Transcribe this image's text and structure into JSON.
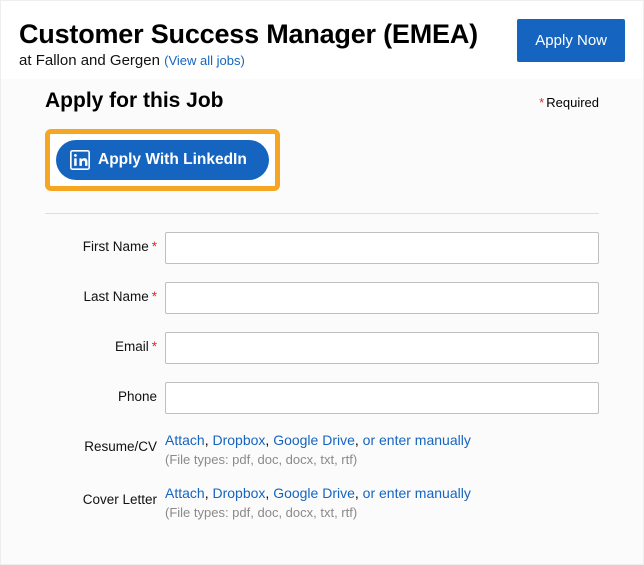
{
  "header": {
    "job_title": "Customer Success Manager (EMEA)",
    "at_prefix": "at ",
    "company": "Fallon and Gergen",
    "view_all": "(View all jobs)",
    "apply_now": "Apply Now"
  },
  "form": {
    "title": "Apply for this Job",
    "required_label": "Required",
    "linkedin_button": "Apply With LinkedIn",
    "fields": {
      "first_name": {
        "label": "First Name",
        "required": true
      },
      "last_name": {
        "label": "Last Name",
        "required": true
      },
      "email": {
        "label": "Email",
        "required": true
      },
      "phone": {
        "label": "Phone",
        "required": false
      },
      "resume": {
        "label": "Resume/CV"
      },
      "cover": {
        "label": "Cover Letter"
      }
    },
    "attach": {
      "links": {
        "attach": "Attach",
        "dropbox": "Dropbox",
        "gdrive": "Google Drive",
        "manual": "or enter manually"
      },
      "sep": ", ",
      "hint": "(File types: pdf, doc, docx, txt, rtf)"
    }
  }
}
